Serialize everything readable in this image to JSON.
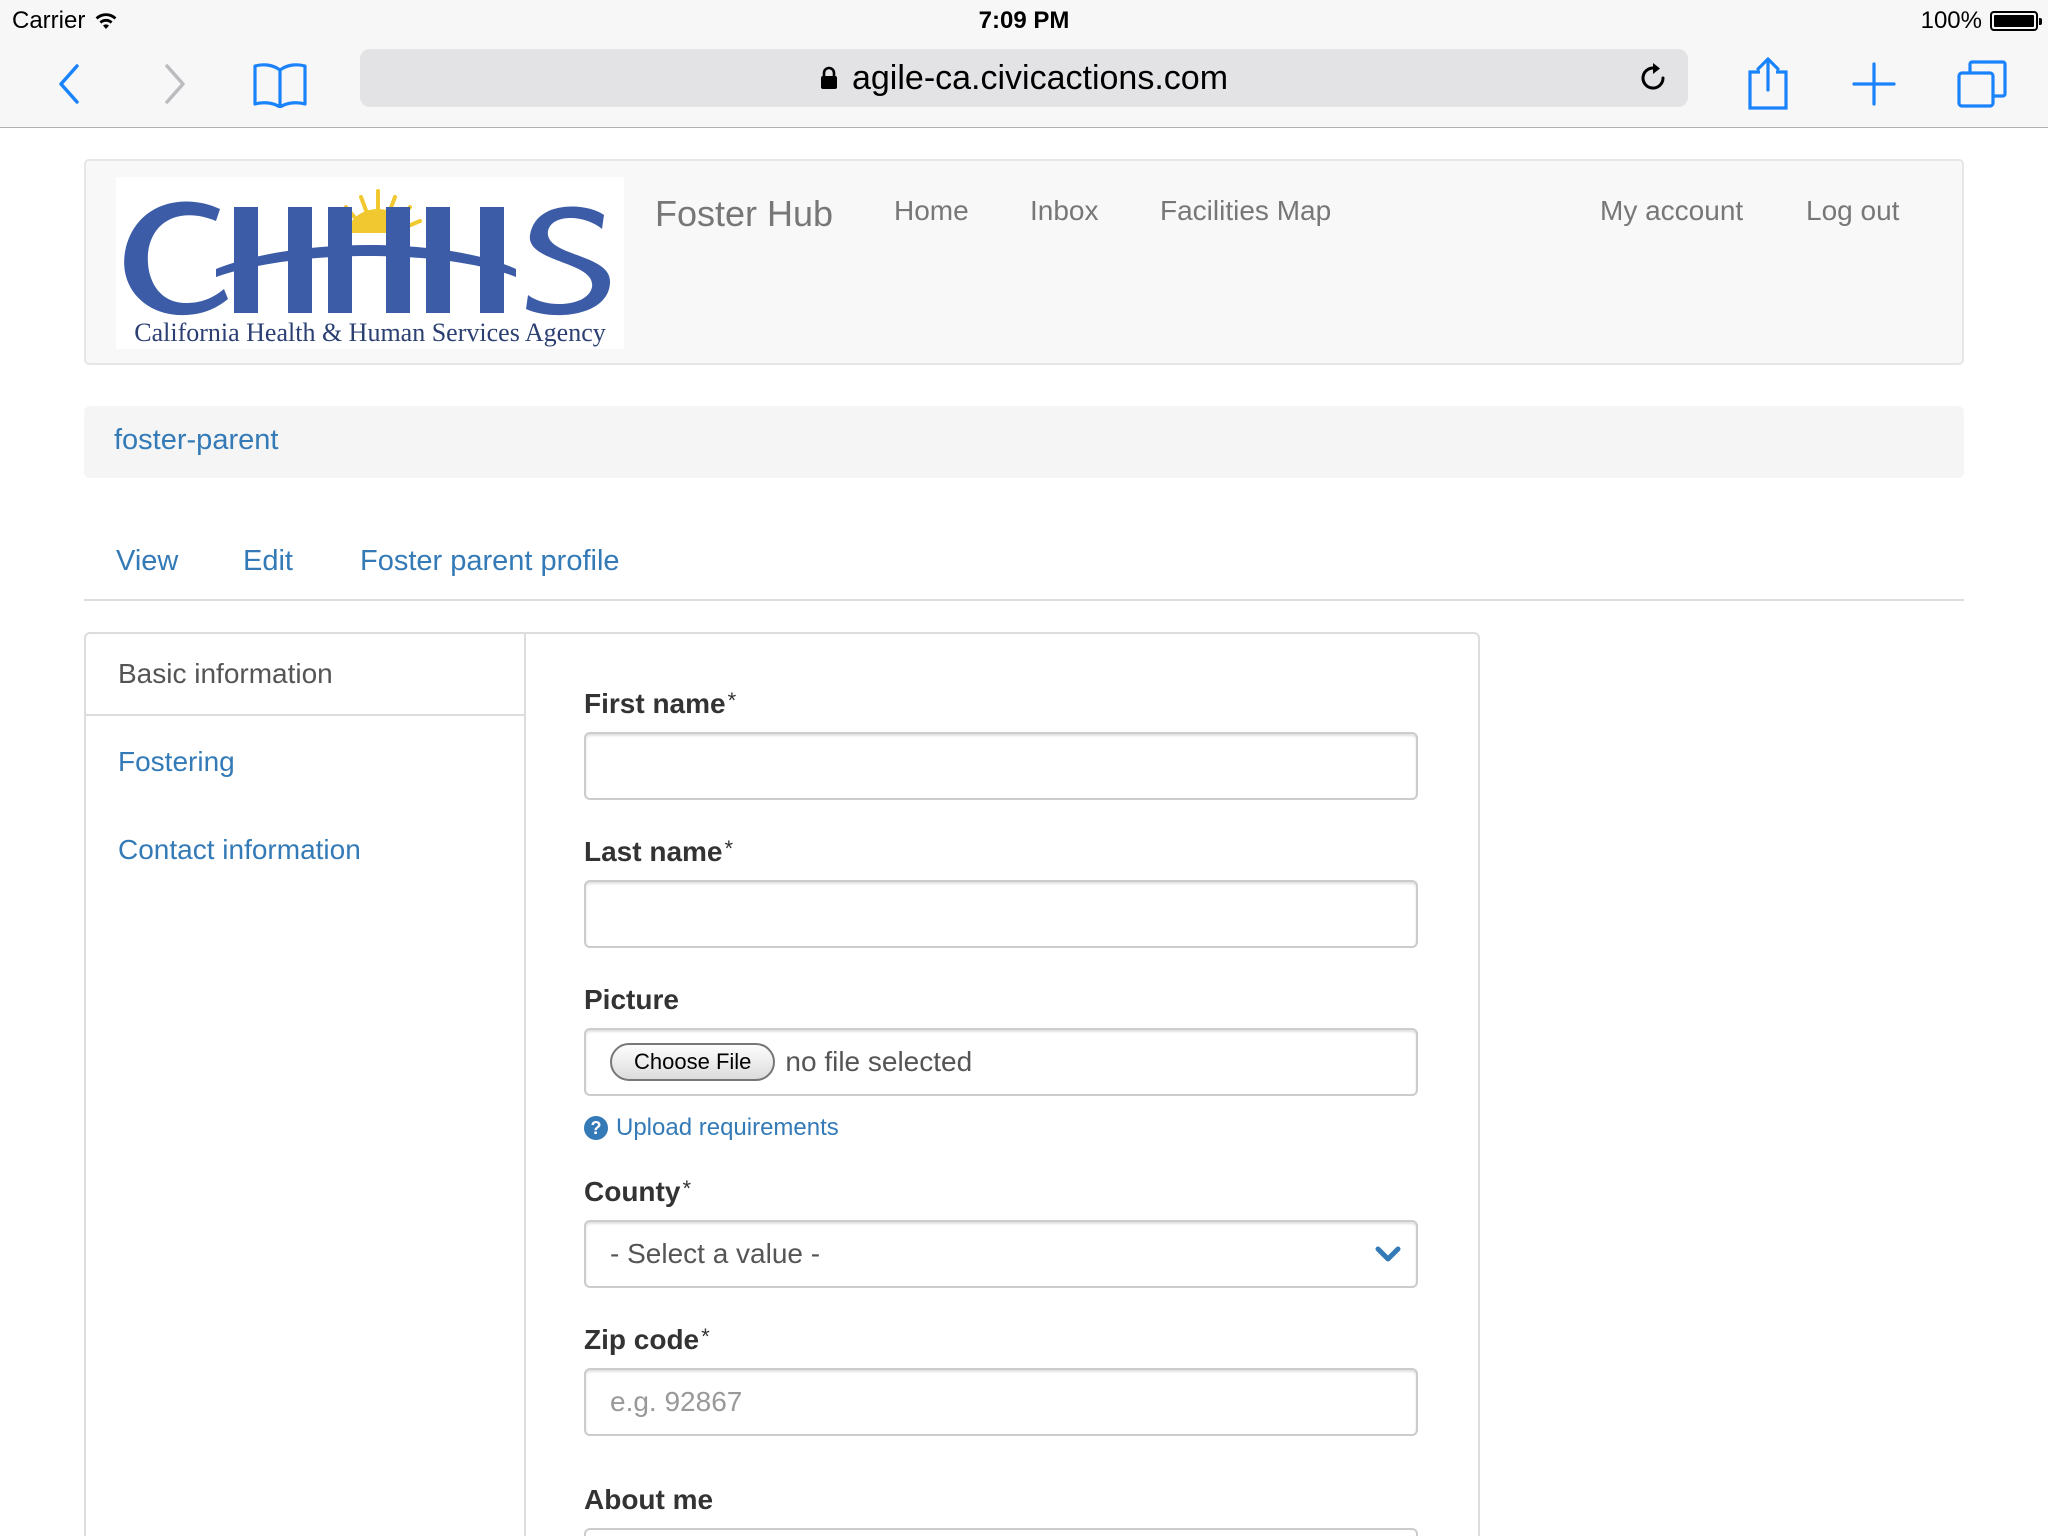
{
  "status_bar": {
    "carrier": "Carrier",
    "time": "7:09 PM",
    "battery": "100%"
  },
  "browser": {
    "url": "agile-ca.civicactions.com",
    "icons": [
      "back-icon",
      "forward-icon",
      "bookmarks-icon",
      "lock-icon",
      "reload-icon",
      "share-icon",
      "new-tab-icon",
      "tabs-icon"
    ]
  },
  "header": {
    "logo_text": "CHHS",
    "logo_subtitle": "California Health & Human Services Agency",
    "brand": "Foster Hub",
    "nav": [
      "Home",
      "Inbox",
      "Facilities Map"
    ],
    "nav_right": [
      "My account",
      "Log out"
    ]
  },
  "breadcrumb": "foster-parent",
  "tabs": [
    "View",
    "Edit",
    "Foster parent profile"
  ],
  "side_tabs": {
    "active": "Basic information",
    "items": [
      "Fostering",
      "Contact information"
    ]
  },
  "form": {
    "first_name_label": "First name",
    "last_name_label": "Last name",
    "required_mark": "*",
    "picture_label": "Picture",
    "choose_file": "Choose File",
    "no_file": "no file selected",
    "upload_help": "Upload requirements",
    "county_label": "County",
    "county_value": "- Select a value -",
    "zip_label": "Zip code",
    "zip_placeholder": "e.g. 92867",
    "about_label": "About me"
  },
  "colors": {
    "link": "#337ab7",
    "ios_blue": "#1a82fb",
    "logo_blue": "#3d5ca8",
    "logo_gold": "#f2c830"
  }
}
